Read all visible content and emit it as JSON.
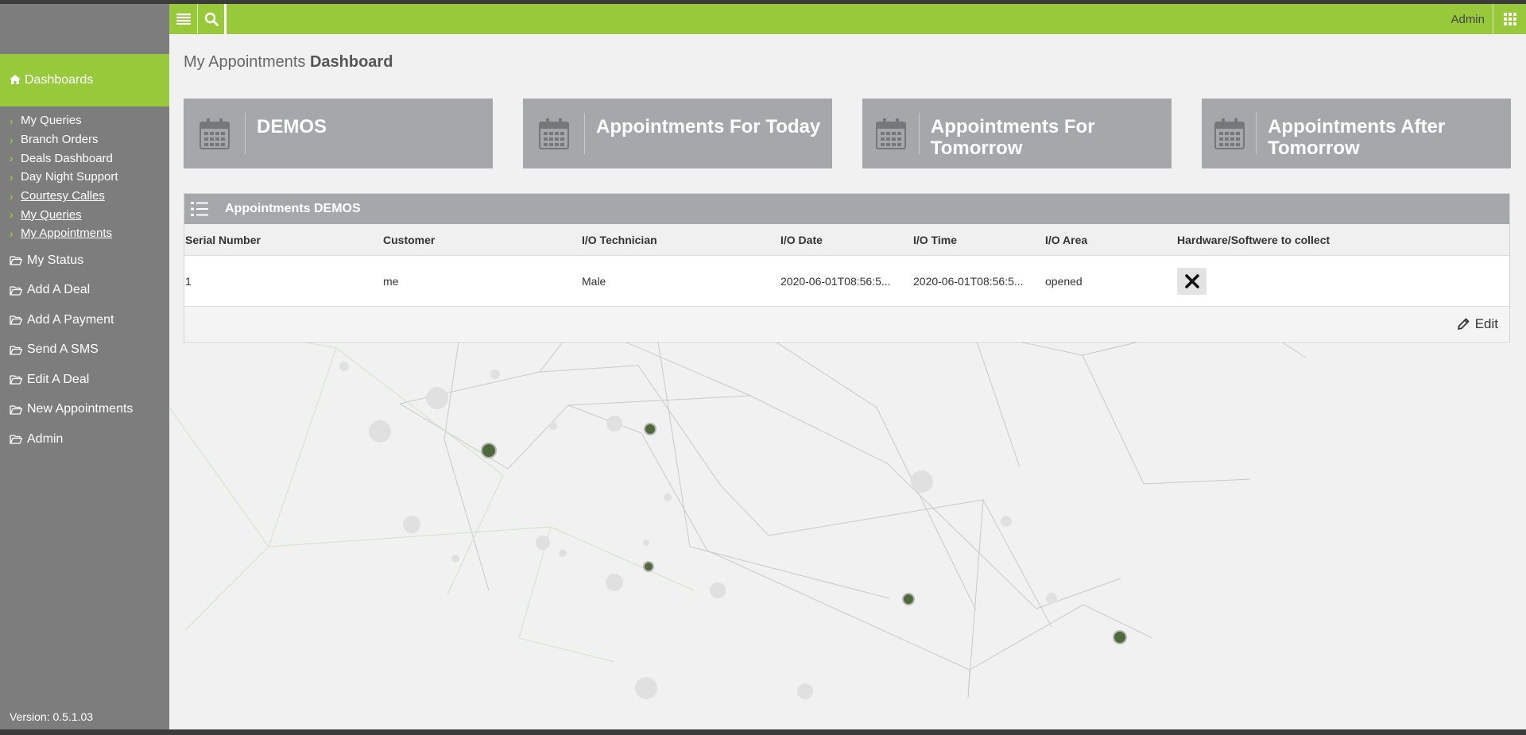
{
  "topbar": {
    "user": "Admin",
    "menu_icon": "list-menu-icon",
    "search_icon": "search-icon",
    "apps_icon": "grid-icon"
  },
  "sidebar": {
    "dashboards_label": "Dashboards",
    "sub_items": [
      {
        "label": "My Queries"
      },
      {
        "label": "Branch Orders"
      },
      {
        "label": "Deals Dashboard"
      },
      {
        "label": "Day Night Support"
      },
      {
        "label": " Courtesy Calles"
      },
      {
        "label": " My Queries"
      },
      {
        "label": " My Appointments"
      }
    ],
    "main_items": [
      {
        "label": " My Status"
      },
      {
        "label": "Add A Deal"
      },
      {
        "label": "Add A Payment"
      },
      {
        "label": "Send A SMS"
      },
      {
        "label": "Edit A Deal"
      },
      {
        "label": "New Appointments"
      },
      {
        "label": "Admin"
      }
    ],
    "version": "Version: 0.5.1.03"
  },
  "page": {
    "title_prefix": "My Appointments ",
    "title_bold": "Dashboard"
  },
  "tiles": [
    {
      "label": "DEMOS"
    },
    {
      "label": "Appointments For Today"
    },
    {
      "label": "Appointments For Tomorrow"
    },
    {
      "label": "Appointments After Tomorrow"
    }
  ],
  "panel": {
    "title": "Appointments DEMOS",
    "columns": [
      "Serial Number",
      "Customer",
      "I/O Technician",
      "I/O Date",
      "I/O Time",
      "I/O Area",
      "Hardware/Softwere to collect"
    ],
    "rows": [
      {
        "serial": "1",
        "customer": "me",
        "technician": "Male",
        "date": "2020-06-01T08:56:5...",
        "time": "2020-06-01T08:56:5...",
        "area": "opened"
      }
    ],
    "edit_label": "Edit"
  },
  "colors": {
    "accent": "#97c93b",
    "sidebar": "#7d7d7d",
    "tile": "#a6a7aa"
  }
}
